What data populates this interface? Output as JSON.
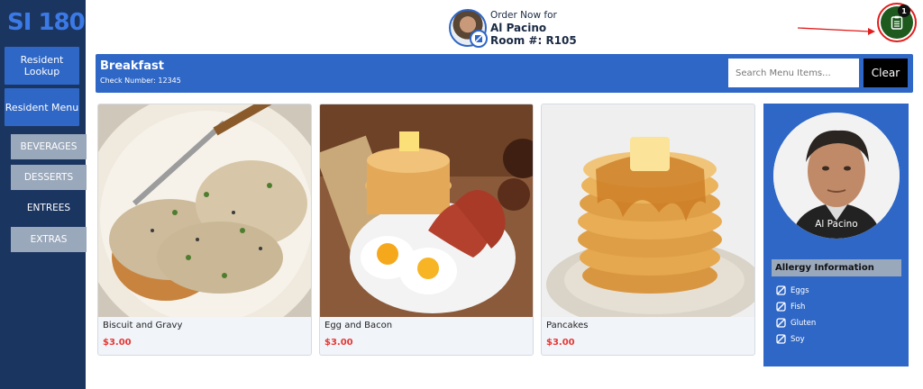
{
  "app": {
    "logo": "SI 180"
  },
  "sidebar": {
    "resident_lookup": "Resident Lookup",
    "resident_menu": "Resident Menu",
    "categories": [
      {
        "label": "BEVERAGES",
        "active": false
      },
      {
        "label": "DESSERTS",
        "active": false
      },
      {
        "label": "ENTREES",
        "active": true
      },
      {
        "label": "EXTRAS",
        "active": false
      }
    ]
  },
  "header": {
    "order_now": "Order Now for",
    "resident_name": "Al Pacino",
    "room": "Room #: R105",
    "cart_count": "1"
  },
  "menu": {
    "title": "Breakfast",
    "check_number": "Check Number: 12345",
    "search_placeholder": "Search Menu Items...",
    "clear_label": "Clear"
  },
  "items": [
    {
      "name": "Biscuit and Gravy",
      "price": "$3.00"
    },
    {
      "name": "Egg and Bacon",
      "price": "$3.00"
    },
    {
      "name": "Pancakes",
      "price": "$3.00"
    }
  ],
  "resident_panel": {
    "name": "Al Pacino",
    "allergy_title": "Allergy Information",
    "allergies": [
      "Eggs",
      "Fish",
      "Gluten",
      "Soy"
    ]
  },
  "colors": {
    "sidebar": "#1b3561",
    "accent": "#2f67c6",
    "price": "#e53935",
    "cart": "#1e5a1e",
    "highlight": "#e11d1d"
  }
}
